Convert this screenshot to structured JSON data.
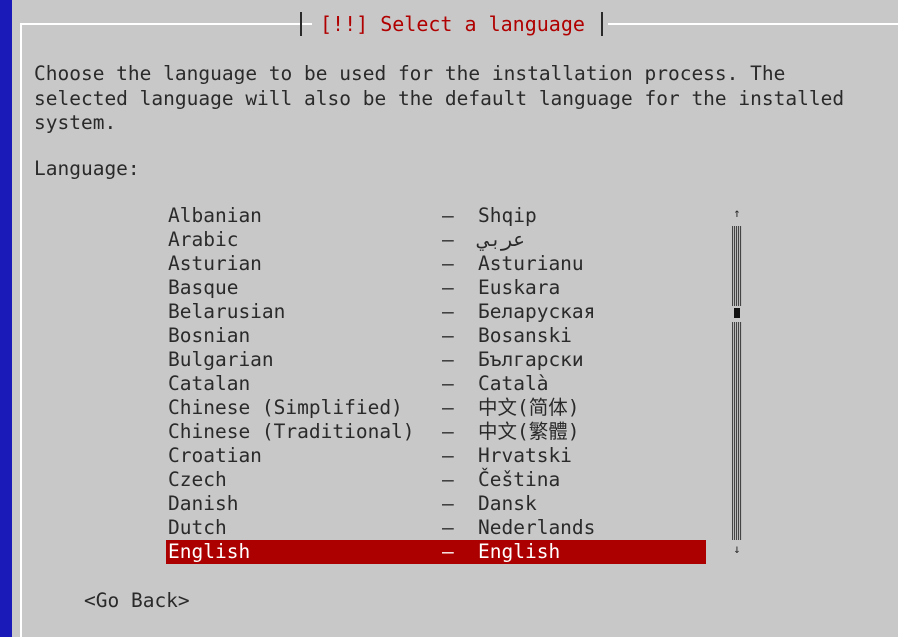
{
  "dialog": {
    "title": "[!!] Select a language",
    "prompt": "Choose the language to be used for the installation process. The\nselected language will also be the default language for the installed\nsystem.",
    "language_label": "Language:"
  },
  "languages": [
    {
      "name": "Albanian",
      "native": "Shqip"
    },
    {
      "name": "Arabic",
      "native": "عربي"
    },
    {
      "name": "Asturian",
      "native": "Asturianu"
    },
    {
      "name": "Basque",
      "native": "Euskara"
    },
    {
      "name": "Belarusian",
      "native": "Беларуская"
    },
    {
      "name": "Bosnian",
      "native": "Bosanski"
    },
    {
      "name": "Bulgarian",
      "native": "Български"
    },
    {
      "name": "Catalan",
      "native": "Català"
    },
    {
      "name": "Chinese (Simplified)",
      "native": "中文(简体)"
    },
    {
      "name": "Chinese (Traditional)",
      "native": "中文(繁體)"
    },
    {
      "name": "Croatian",
      "native": "Hrvatski"
    },
    {
      "name": "Czech",
      "native": "Čeština"
    },
    {
      "name": "Danish",
      "native": "Dansk"
    },
    {
      "name": "Dutch",
      "native": "Nederlands"
    },
    {
      "name": "English",
      "native": "English"
    }
  ],
  "separator": "–",
  "selected_language": "English",
  "buttons": {
    "go_back": "<Go Back>"
  },
  "scrollbar": {
    "up_arrow": "↑",
    "down_arrow": "↓"
  },
  "colors": {
    "background": "#1a1ab8",
    "dialog": "#c8c8c8",
    "title": "#b00000",
    "selection": "#ac0000"
  }
}
